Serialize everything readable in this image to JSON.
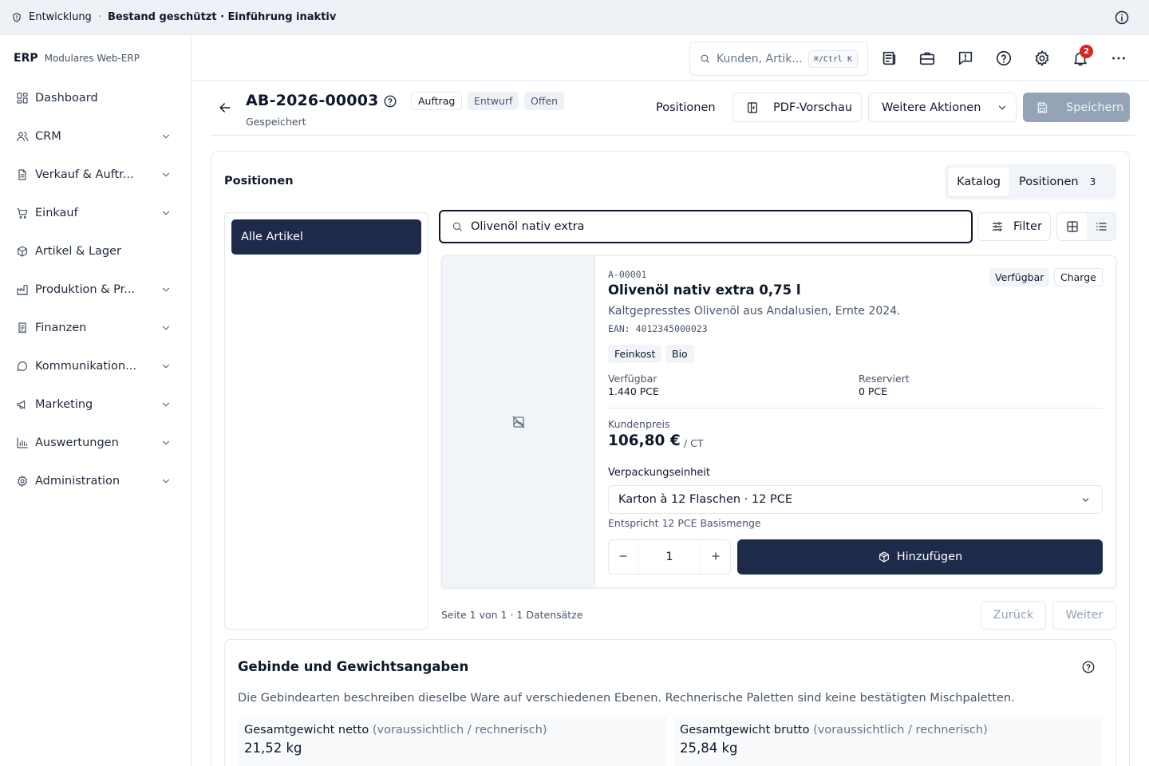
{
  "env_bar": {
    "environment": "Entwicklung",
    "separator": "·",
    "status": "Bestand geschützt · Einführung inaktiv"
  },
  "brand": {
    "name": "ERP",
    "subtitle": "Modulares Web-ERP"
  },
  "sidebar": {
    "items": [
      {
        "label": "Dashboard",
        "icon": "dashboard-icon",
        "expandable": false
      },
      {
        "label": "CRM",
        "icon": "users-icon",
        "expandable": true
      },
      {
        "label": "Verkauf & Auftr...",
        "icon": "document-icon",
        "expandable": true
      },
      {
        "label": "Einkauf",
        "icon": "cart-icon",
        "expandable": true
      },
      {
        "label": "Artikel & Lager",
        "icon": "package-icon",
        "expandable": false
      },
      {
        "label": "Produktion & Pr...",
        "icon": "factory-icon",
        "expandable": true
      },
      {
        "label": "Finanzen",
        "icon": "receipt-icon",
        "expandable": true
      },
      {
        "label": "Kommunikation...",
        "icon": "chat-icon",
        "expandable": true
      },
      {
        "label": "Marketing",
        "icon": "megaphone-icon",
        "expandable": true
      },
      {
        "label": "Auswertungen",
        "icon": "bar-chart-icon",
        "expandable": true
      },
      {
        "label": "Administration",
        "icon": "gear-icon",
        "expandable": true
      }
    ]
  },
  "topbar": {
    "search_placeholder": "Kunden, Artik...",
    "search_shortcut": "⌘/Ctrl K",
    "notification_count": "2",
    "icons": [
      "news-icon",
      "briefcase-icon",
      "feedback-icon",
      "help-icon",
      "settings-icon",
      "bell-icon",
      "more-icon"
    ]
  },
  "document": {
    "number": "AB-2026-00003",
    "status_text": "Gespeichert",
    "badges": [
      "Auftrag",
      "Entwurf",
      "Offen"
    ],
    "actions": {
      "positions": "Positionen",
      "pdf_preview": "PDF-Vorschau",
      "more_actions": "Weitere Aktionen",
      "save": "Speichern"
    }
  },
  "positions_card": {
    "title": "Positionen",
    "tabs": {
      "catalog": "Katalog",
      "positions": "Positionen",
      "positions_count": "3"
    },
    "category": "Alle Artikel",
    "search_value": "Olivenöl nativ extra",
    "filter_label": "Filter",
    "view_mode": "list",
    "pagination": {
      "info": "Seite 1 von 1 · 1 Datensätze",
      "prev": "Zurück",
      "next": "Weiter"
    }
  },
  "product": {
    "sku": "A-00001",
    "name": "Olivenöl nativ extra 0,75 l",
    "description": "Kaltgepresstes Olivenöl aus Andalusien, Ernte 2024.",
    "ean": "EAN: 4012345000023",
    "tags": [
      "Feinkost",
      "Bio"
    ],
    "status_badges": [
      "Verfügbar",
      "Charge"
    ],
    "available_label": "Verfügbar",
    "available_value": "1.440 PCE",
    "reserved_label": "Reserviert",
    "reserved_value": "0 PCE",
    "price_label": "Kundenpreis",
    "price": "106,80 €",
    "price_unit": "/ CT",
    "packaging_label": "Verpackungseinheit",
    "packaging_value": "Karton à 12 Flaschen · 12 PCE",
    "packaging_hint": "Entspricht 12 PCE Basismenge",
    "quantity": "1",
    "add_label": "Hinzufügen"
  },
  "weights_card": {
    "title": "Gebinde und Gewichtsangaben",
    "description": "Die Gebindearten beschreiben dieselbe Ware auf verschiedenen Ebenen. Rechnerische Paletten sind keine bestätigten Mischpaletten.",
    "net_label": "Gesamtgewicht netto",
    "net_note": "(voraussichtlich / rechnerisch)",
    "net_value": "21,52 kg",
    "gross_label": "Gesamtgewicht brutto",
    "gross_note": "(voraussichtlich / rechnerisch)",
    "gross_value": "25,84 kg"
  },
  "colors": {
    "primary": "#1e2a4a",
    "notification": "#dc2626",
    "disabled_button": "#94a3b8",
    "border": "#e2e8f0",
    "muted_text": "#475569"
  }
}
